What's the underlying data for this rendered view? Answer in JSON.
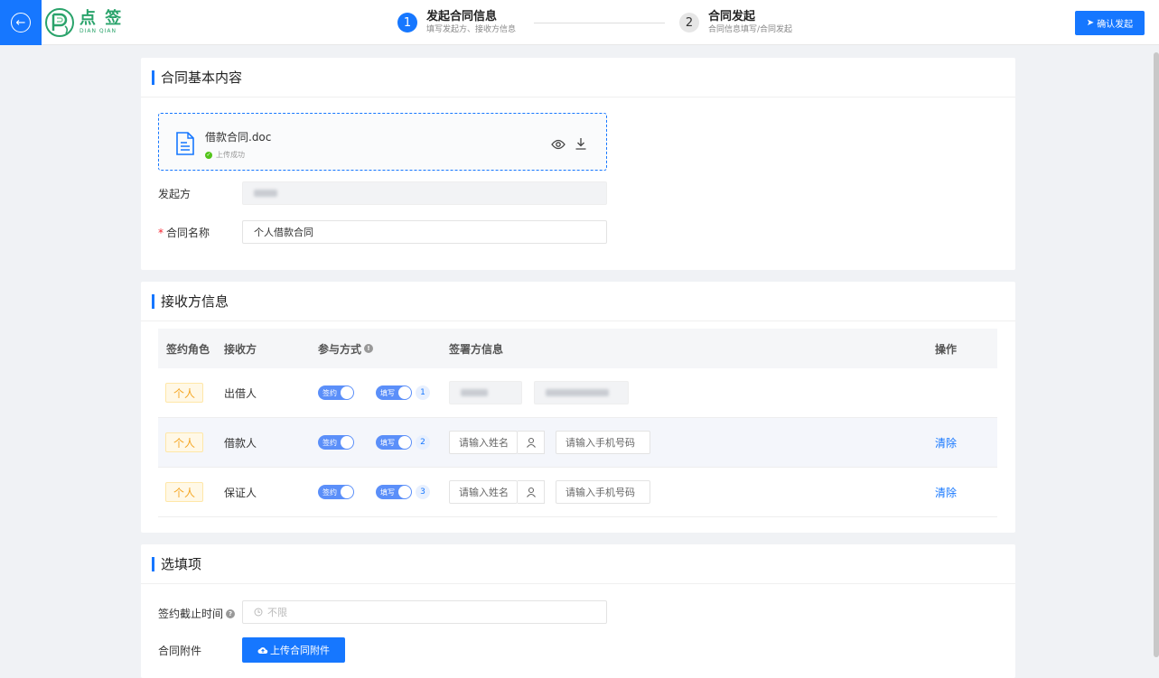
{
  "header": {
    "logo_cn": "点 签",
    "logo_en": "DIAN QIAN",
    "steps": [
      {
        "num": "1",
        "title": "发起合同信息",
        "sub": "填写发起方、接收方信息"
      },
      {
        "num": "2",
        "title": "合同发起",
        "sub": "合同信息填写/合同发起"
      }
    ],
    "confirm_label": "确认发起"
  },
  "basic": {
    "title": "合同基本内容",
    "file_name": "借款合同.doc",
    "file_status": "上传成功",
    "initiator_label": "发起方",
    "contract_name_label": "合同名称",
    "contract_name_value": "个人借款合同"
  },
  "receivers": {
    "title": "接收方信息",
    "columns": {
      "role": "签约角色",
      "receiver": "接收方",
      "mode": "参与方式",
      "signer": "签署方信息",
      "op": "操作"
    },
    "rows": [
      {
        "role": "个人",
        "receiver": "出借人",
        "sign": "签约",
        "fill": "填写",
        "order": "1",
        "clear": ""
      },
      {
        "role": "个人",
        "receiver": "借款人",
        "sign": "签约",
        "fill": "填写",
        "order": "2",
        "name_placeholder": "请输入姓名",
        "phone_placeholder": "请输入手机号码",
        "clear": "清除"
      },
      {
        "role": "个人",
        "receiver": "保证人",
        "sign": "签约",
        "fill": "填写",
        "order": "3",
        "name_placeholder": "请输入姓名",
        "phone_placeholder": "请输入手机号码",
        "clear": "清除"
      }
    ]
  },
  "optional": {
    "title": "选填项",
    "deadline_label": "签约截止时间",
    "deadline_placeholder": "不限",
    "attach_label": "合同附件",
    "upload_label": "上传合同附件"
  }
}
